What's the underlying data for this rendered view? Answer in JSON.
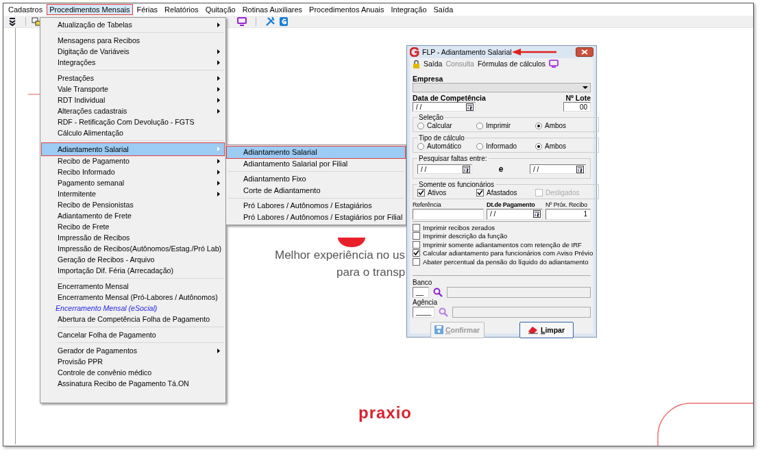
{
  "menubar": [
    {
      "label": "Cadastros",
      "selected": false
    },
    {
      "label": "Procedimentos Mensais",
      "selected": true
    },
    {
      "label": "Férias",
      "selected": false
    },
    {
      "label": "Relatórios",
      "selected": false
    },
    {
      "label": "Quitação",
      "selected": false
    },
    {
      "label": "Rotinas Auxiliares",
      "selected": false
    },
    {
      "label": "Procedimentos Anuais",
      "selected": false
    },
    {
      "label": "Integração",
      "selected": false
    },
    {
      "label": "Saída",
      "selected": false
    }
  ],
  "menu": [
    [
      {
        "label": "Atualização de Tabelas",
        "submenu": true,
        "selected": false,
        "kind": "normal"
      }
    ],
    [
      {
        "label": "Mensagens para Recibos",
        "submenu": false,
        "selected": false,
        "kind": "normal"
      },
      {
        "label": "Digitação de Variáveis",
        "submenu": true,
        "selected": false,
        "kind": "normal"
      },
      {
        "label": "Integrações",
        "submenu": true,
        "selected": false,
        "kind": "normal"
      }
    ],
    [
      {
        "label": "Prestações",
        "submenu": true,
        "selected": false,
        "kind": "normal"
      },
      {
        "label": "Vale Transporte",
        "submenu": true,
        "selected": false,
        "kind": "normal"
      },
      {
        "label": "RDT Individual",
        "submenu": true,
        "selected": false,
        "kind": "normal"
      },
      {
        "label": "Alterações cadastrais",
        "submenu": true,
        "selected": false,
        "kind": "normal"
      },
      {
        "label": "RDF - Retificação Com Devolução - FGTS",
        "submenu": false,
        "selected": false,
        "kind": "normal"
      },
      {
        "label": "Cálculo Alimentação",
        "submenu": false,
        "selected": false,
        "kind": "normal"
      }
    ],
    [
      {
        "label": "Adiantamento Salarial",
        "submenu": true,
        "selected": true,
        "kind": "normal"
      },
      {
        "label": "Recibo de Pagamento",
        "submenu": true,
        "selected": false,
        "kind": "normal"
      },
      {
        "label": "Recibo Informado",
        "submenu": true,
        "selected": false,
        "kind": "normal"
      },
      {
        "label": "Pagamento semanal",
        "submenu": true,
        "selected": false,
        "kind": "normal"
      },
      {
        "label": "Intermitente",
        "submenu": true,
        "selected": false,
        "kind": "normal"
      },
      {
        "label": "Recibo de Pensionistas",
        "submenu": false,
        "selected": false,
        "kind": "normal"
      },
      {
        "label": "Adiantamento de Frete",
        "submenu": false,
        "selected": false,
        "kind": "normal"
      },
      {
        "label": "Recibo de Frete",
        "submenu": false,
        "selected": false,
        "kind": "normal"
      },
      {
        "label": "Impressão de Recibos",
        "submenu": false,
        "selected": false,
        "kind": "normal"
      },
      {
        "label": "Impressão de Recibos(Autônomos/Estag./Pró Lab)",
        "submenu": false,
        "selected": false,
        "kind": "normal"
      },
      {
        "label": "Geração de Recibos - Arquivo",
        "submenu": false,
        "selected": false,
        "kind": "normal"
      },
      {
        "label": "Importação Dif. Féria (Arrecadação)",
        "submenu": false,
        "selected": false,
        "kind": "normal"
      }
    ],
    [
      {
        "label": "Encerramento Mensal",
        "submenu": false,
        "selected": false,
        "kind": "normal"
      },
      {
        "label": "Encerramento Mensal (Pró-Labores / Autônomos)",
        "submenu": false,
        "selected": false,
        "kind": "normal"
      },
      {
        "label": "Encerramento Mensal (eSocial)",
        "submenu": false,
        "selected": false,
        "kind": "link"
      },
      {
        "label": "Abertura de Competência Folha de Pagamento",
        "submenu": false,
        "selected": false,
        "kind": "normal"
      }
    ],
    [
      {
        "label": "Cancelar Folha de Pagamento",
        "submenu": false,
        "selected": false,
        "kind": "normal"
      }
    ],
    [
      {
        "label": "Gerador de Pagamentos",
        "submenu": true,
        "selected": false,
        "kind": "normal"
      },
      {
        "label": "Provisão PPR",
        "submenu": false,
        "selected": false,
        "kind": "normal"
      },
      {
        "label": "Controle de convênio médico",
        "submenu": false,
        "selected": false,
        "kind": "normal"
      },
      {
        "label": "Assinatura Recibo de Pagamento Tá.ON",
        "submenu": false,
        "selected": false,
        "kind": "normal"
      }
    ]
  ],
  "submenu": [
    [
      {
        "label": "Adiantamento Salarial",
        "selected": true
      },
      {
        "label": "Adiantamento Salarial por Filial",
        "selected": false
      }
    ],
    [
      {
        "label": "Adiantamento Fixo",
        "selected": false
      },
      {
        "label": "Corte de Adiantamento",
        "selected": false
      }
    ],
    [
      {
        "label": "Pró Labores / Autônomos / Estagiários",
        "selected": false
      },
      {
        "label": "Pró Labores / Autônomos / Estagiários por Filial",
        "selected": false
      }
    ]
  ],
  "background": {
    "tagline": [
      "Melhor experiência no us",
      "para o transp"
    ],
    "brand": "praxio"
  },
  "dialog": {
    "title": "FLP - Adiantamento Salarial",
    "menu": [
      {
        "label": "Saída",
        "disabled": false
      },
      {
        "label": "Consulta",
        "disabled": true
      },
      {
        "label": "Fórmulas de cálculos",
        "disabled": false
      }
    ],
    "empresa": {
      "label": "Empresa"
    },
    "competencia": {
      "label": "Data de Competência",
      "value": "/ /"
    },
    "lote": {
      "label": "Nº Lote",
      "value": "00"
    },
    "groups": [
      {
        "title": "Seleção",
        "options": [
          {
            "label": "Calcular",
            "selected": false
          },
          {
            "label": "Imprimir",
            "selected": false
          },
          {
            "label": "Ambos",
            "selected": true
          }
        ]
      },
      {
        "title": "Tipo de cálculo",
        "options": [
          {
            "label": "Automático",
            "selected": false
          },
          {
            "label": "Informado",
            "selected": false
          },
          {
            "label": "Ambos",
            "selected": true
          }
        ]
      }
    ],
    "faltas": {
      "title": "Pesquisar faltas entre:",
      "from": "/ /",
      "joiner": "e",
      "to": "/ /"
    },
    "funcionarios": {
      "title": "Somente os funcionários",
      "options": [
        {
          "label": "Ativos",
          "checked": true,
          "disabled": false
        },
        {
          "label": "Afastados",
          "checked": true,
          "disabled": false
        },
        {
          "label": "Desligados",
          "checked": false,
          "disabled": true
        }
      ]
    },
    "referencia": {
      "label": "Referência"
    },
    "pagamento": {
      "label": "Dt.de Pagamento",
      "value": "/ /"
    },
    "recibo": {
      "label": "Nº Próx. Recibo",
      "value": "1"
    },
    "options": [
      {
        "label": "Imprimir recibos zerados",
        "checked": false
      },
      {
        "label": "Imprimir descrição da função",
        "checked": false
      },
      {
        "label": "Imprimir somente adiantamentos com retenção de IRF",
        "checked": false
      },
      {
        "label": "Calcular adiantamento para funcionários com Aviso Prévio",
        "checked": true
      },
      {
        "label": "Abater percentual da pensão do líquido do adiantamento",
        "checked": false
      }
    ],
    "banco": {
      "label": "Banco",
      "value": "__"
    },
    "agencia": {
      "label": "Agência",
      "value": "____"
    },
    "buttons": [
      {
        "label": "Confirmar",
        "disabled": true,
        "kind": "save"
      },
      {
        "label": "Limpar",
        "disabled": false,
        "kind": "clear"
      }
    ]
  }
}
